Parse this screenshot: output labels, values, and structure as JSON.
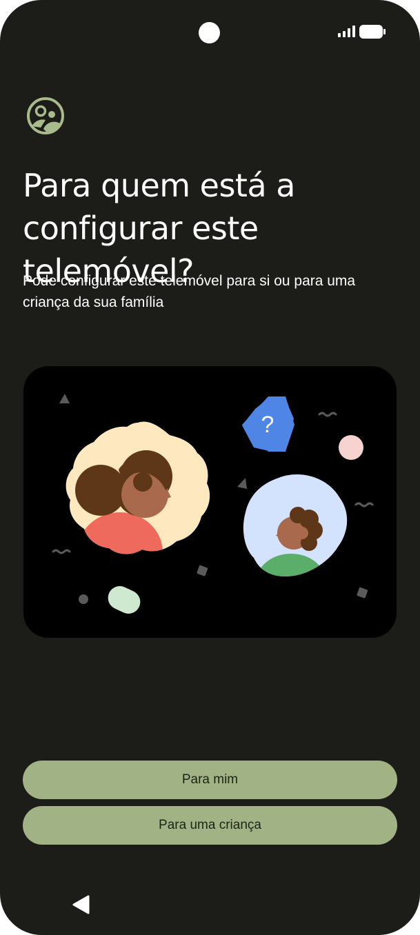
{
  "header": {
    "icon": "supervised-user-icon",
    "title": "Para quem está a configurar este telemóvel?",
    "subtitle": "Pode configurar este telemóvel para si ou para uma criança da sua família"
  },
  "illustration": {
    "badge_text": "?"
  },
  "actions": {
    "for_me_label": "Para mim",
    "for_child_label": "Para uma criança"
  },
  "colors": {
    "background": "#1c1c19",
    "button": "#a1b284",
    "accent_icon": "#a9bb8a"
  },
  "system": {
    "nav_icon": "back-triangle-icon"
  }
}
